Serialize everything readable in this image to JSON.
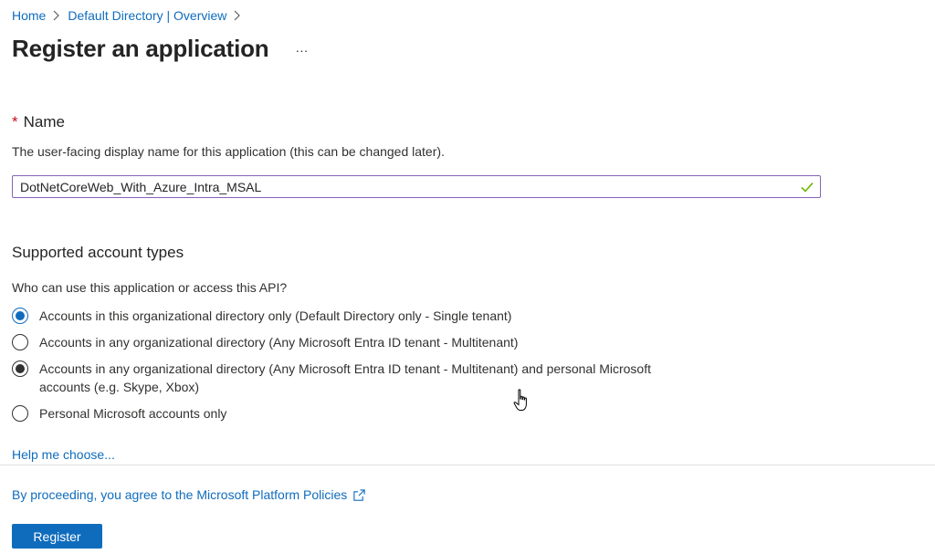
{
  "breadcrumb": {
    "home": "Home",
    "directory": "Default Directory | Overview"
  },
  "page": {
    "title": "Register an application",
    "more_label": "···"
  },
  "name_section": {
    "required_marker": "*",
    "heading": "Name",
    "description": "The user-facing display name for this application (this can be changed later).",
    "value": "DotNetCoreWeb_With_Azure_Intra_MSAL"
  },
  "account_types": {
    "heading": "Supported account types",
    "question": "Who can use this application or access this API?",
    "options": [
      {
        "label": "Accounts in this organizational directory only (Default Directory only - Single tenant)"
      },
      {
        "label": "Accounts in any organizational directory (Any Microsoft Entra ID tenant - Multitenant)"
      },
      {
        "label_line1": "Accounts in any organizational directory (Any Microsoft Entra ID tenant - Multitenant) and personal Microsoft",
        "label_line2": "accounts (e.g. Skype, Xbox)"
      },
      {
        "label": "Personal Microsoft accounts only"
      }
    ],
    "help_link": "Help me choose..."
  },
  "footer": {
    "policy_text": "By proceeding, you agree to the Microsoft Platform Policies",
    "register_label": "Register"
  },
  "colors": {
    "accent": "#0f6cbd",
    "input_border": "#8764b8",
    "check": "#6bb700",
    "required": "#c50f1f"
  }
}
